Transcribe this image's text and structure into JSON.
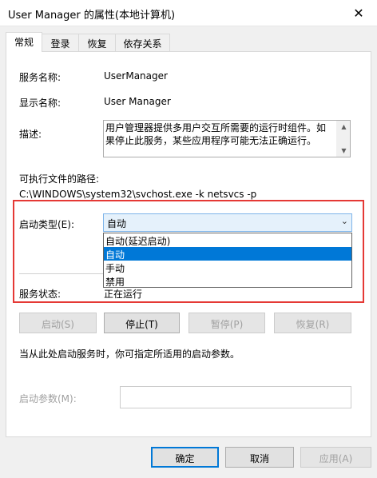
{
  "window": {
    "title": "User Manager 的属性(本地计算机)",
    "close_glyph": "✕"
  },
  "tabs": [
    {
      "label": "常规",
      "active": true
    },
    {
      "label": "登录",
      "active": false
    },
    {
      "label": "恢复",
      "active": false
    },
    {
      "label": "依存关系",
      "active": false
    }
  ],
  "general": {
    "service_name_label": "服务名称:",
    "service_name_value": "UserManager",
    "display_name_label": "显示名称:",
    "display_name_value": "User Manager",
    "description_label": "描述:",
    "description_value": "用户管理器提供多用户交互所需要的运行时组件。如果停止此服务，某些应用程序可能无法正确运行。",
    "exe_path_label": "可执行文件的路径:",
    "exe_path_value": "C:\\WINDOWS\\system32\\svchost.exe -k netsvcs -p",
    "startup_type_label": "启动类型(E):",
    "startup_type_value": "自动",
    "startup_options": [
      "自动(延迟启动)",
      "自动",
      "手动",
      "禁用"
    ],
    "selected_option_index": 1,
    "service_status_label": "服务状态:",
    "service_status_value": "正在运行"
  },
  "service_buttons": {
    "start": "启动(S)",
    "stop": "停止(T)",
    "pause": "暂停(P)",
    "resume": "恢复(R)"
  },
  "hint_text": "当从此处启动服务时，你可指定所适用的启动参数。",
  "start_params_label": "启动参数(M):",
  "start_params_value": "",
  "dialog_buttons": {
    "ok": "确定",
    "cancel": "取消",
    "apply": "应用(A)"
  },
  "colors": {
    "highlight_box": "#e53935",
    "selection": "#0078d7"
  }
}
